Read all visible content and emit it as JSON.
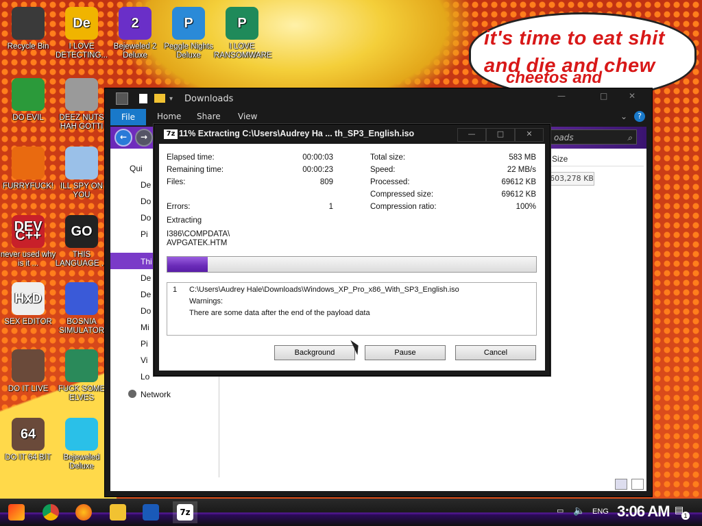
{
  "wallpaper": {
    "speech": "it's time to eat shit\nand die and chew",
    "speech_partial": "cheetos and"
  },
  "desktop_icons": [
    {
      "label": "Recycle Bin",
      "glyph": "",
      "color": "#3a3a3a",
      "icon": "recycle-bin-icon"
    },
    {
      "label": "I LOVE DETECTING...",
      "glyph": "De",
      "color": "#f0b400",
      "icon": "de-app-icon"
    },
    {
      "label": "Bejeweled 2 Deluxe",
      "glyph": "2",
      "color": "#6a2fc8",
      "icon": "bejeweled2-icon"
    },
    {
      "label": "Peggle Nights Deluxe",
      "glyph": "P",
      "color": "#2a8ad8",
      "icon": "peggle-icon"
    },
    {
      "label": "I LOVE RANSOMWARE",
      "glyph": "P",
      "color": "#1f8a5a",
      "icon": "publisher-icon"
    },
    {
      "label": "DO EVIL",
      "glyph": "",
      "color": "#2b9a3a",
      "icon": "chrome-icon"
    },
    {
      "label": "DEEZ NUTS HAH GOTTI",
      "glyph": "",
      "color": "#9a9a9a",
      "icon": "copy-icon"
    },
    {
      "label": "FURRYFUCK!",
      "glyph": "",
      "color": "#e96a10",
      "icon": "firefox-icon"
    },
    {
      "label": "ILL SPY ON YOU",
      "glyph": "",
      "color": "#9ac0e8",
      "icon": "network-spy-icon"
    },
    {
      "label": "never used why is it ...",
      "glyph": "DEV C++",
      "color": "#c8202a",
      "icon": "devcpp-icon"
    },
    {
      "label": "THIS LANGUAGE ...",
      "glyph": "GO",
      "color": "#222",
      "icon": "goland-icon"
    },
    {
      "label": "SEX EDITOR",
      "glyph": "HxD",
      "color": "#eee",
      "icon": "hxd-icon"
    },
    {
      "label": "BOSNIA SIMULATOR",
      "glyph": "",
      "color": "#3a5ad8",
      "icon": "mine-icon"
    },
    {
      "label": "DO IT LIVE",
      "glyph": "",
      "color": "#6a4a3a",
      "icon": "portrait-icon"
    },
    {
      "label": "FUCK SOME ELVES",
      "glyph": "",
      "color": "#2a8a5a",
      "icon": "santa-icon"
    },
    {
      "label": "DO IT 64 BIT",
      "glyph": "64",
      "color": "#6a4a3a",
      "icon": "portrait64-icon"
    },
    {
      "label": "Bejeweled Deluxe",
      "glyph": "",
      "color": "#2ac0e8",
      "icon": "diamond-icon"
    }
  ],
  "explorer": {
    "title": "Downloads",
    "ribbon_tabs": [
      "File",
      "Home",
      "Share",
      "View"
    ],
    "address_placeholder": "oads",
    "nav_items": [
      "Qui",
      "De",
      "Do",
      "Do",
      "Pi",
      "Thi",
      "De",
      "De",
      "Do",
      "Mi",
      "Pi",
      "Vi",
      "Lo",
      "Network"
    ],
    "column_size": "Size",
    "size_value": "603,278 KB"
  },
  "dialog": {
    "logo": "7z",
    "title": "11% Extracting C:\\Users\\Audrey Ha ... th_SP3_English.iso",
    "elapsed_label": "Elapsed time:",
    "elapsed": "00:00:03",
    "remaining_label": "Remaining time:",
    "remaining": "00:00:23",
    "files_label": "Files:",
    "files": "809",
    "errors_label": "Errors:",
    "errors": "1",
    "total_label": "Total size:",
    "total": "583 MB",
    "speed_label": "Speed:",
    "speed": "22 MB/s",
    "processed_label": "Processed:",
    "processed": "69612 KB",
    "compressed_label": "Compressed size:",
    "compressed": "69612 KB",
    "ratio_label": "Compression ratio:",
    "ratio": "100%",
    "extracting_label": "Extracting",
    "current_dir": "I386\\COMPDATA\\",
    "current_file": "AVPGATEK.HTM",
    "progress": 0.11,
    "log_num": "1",
    "log_path": "C:\\Users\\Audrey Hale\\Downloads\\Windows_XP_Pro_x86_With_SP3_English.iso",
    "log_warn": "Warnings:",
    "log_msg": "There are some data after the end of the payload data",
    "btn_background": "Background",
    "btn_pause": "Pause",
    "btn_cancel": "Cancel"
  },
  "taskbar": {
    "lang": "ENG",
    "clock": "3:06 AM",
    "notif_count": "1"
  }
}
